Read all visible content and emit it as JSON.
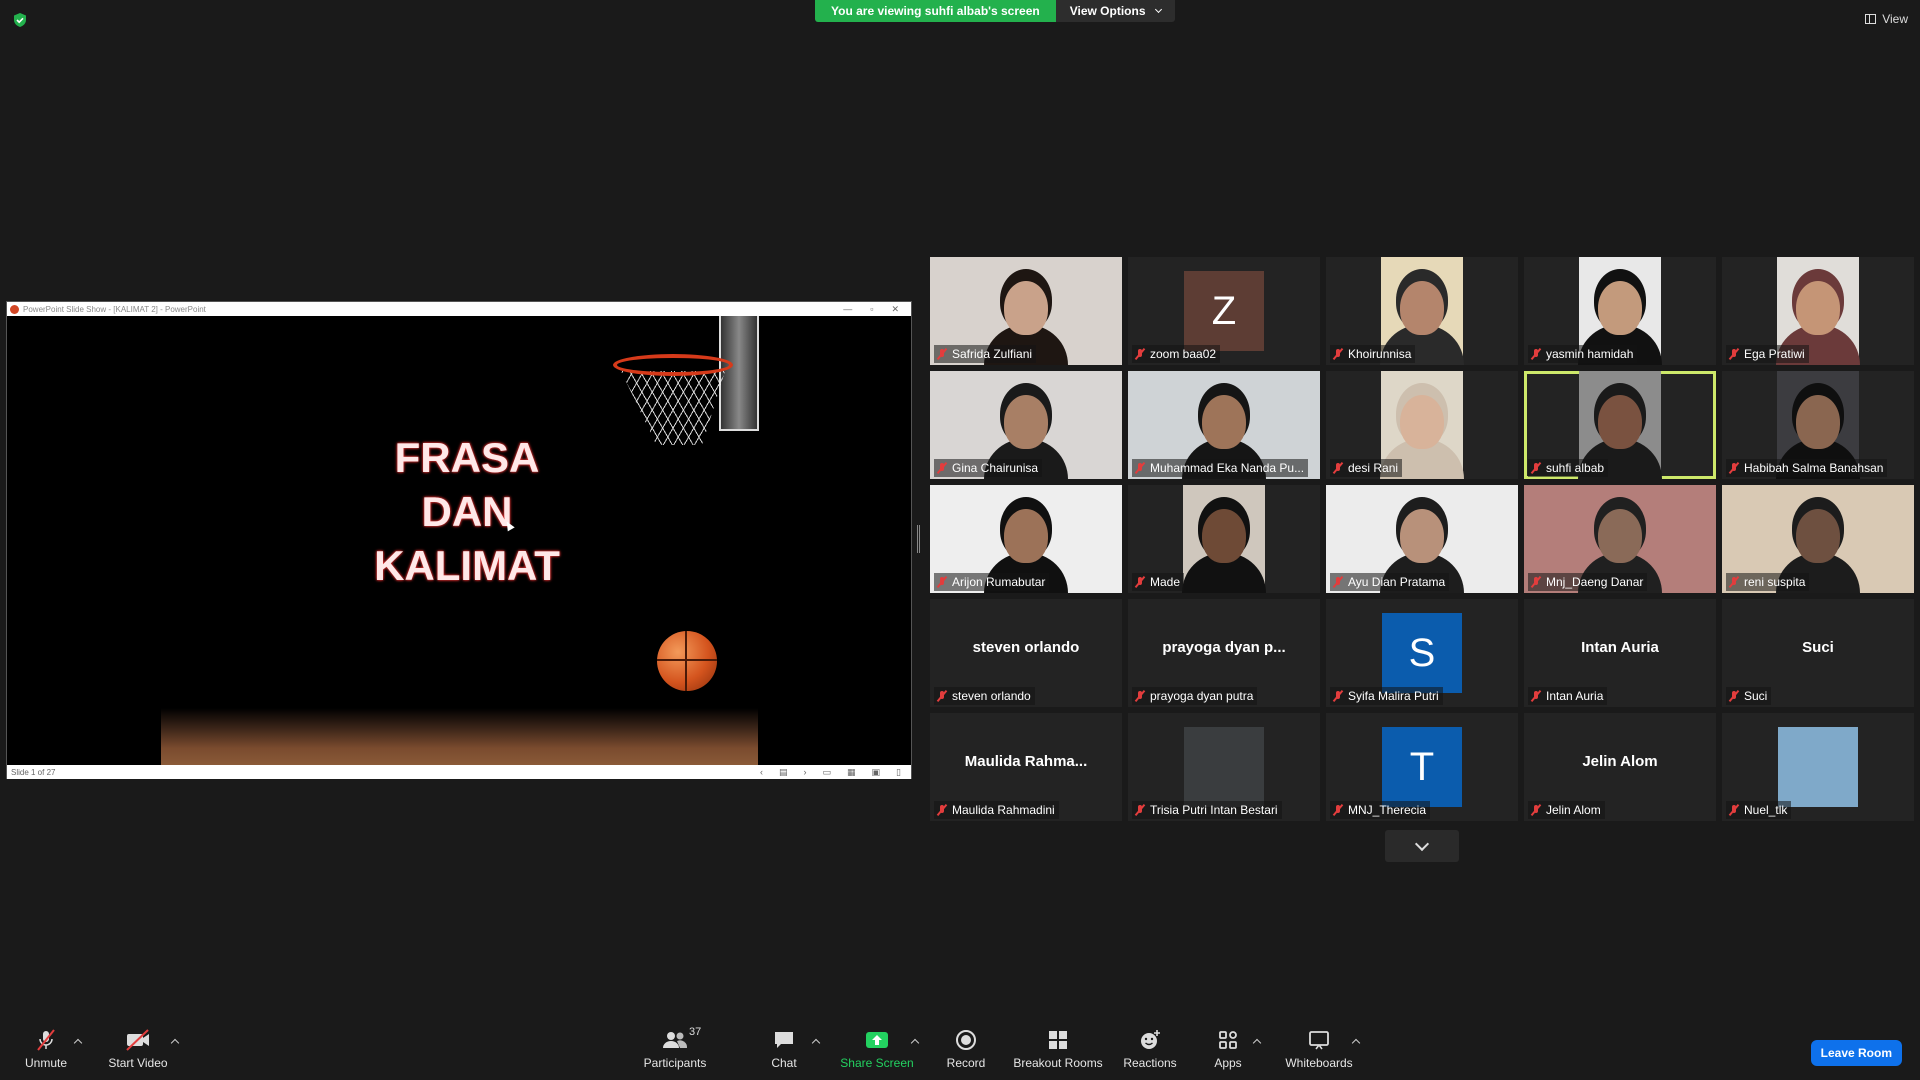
{
  "top": {
    "viewing_text": "You are viewing suhfi albab's screen",
    "view_options_label": "View Options",
    "view_label": "View"
  },
  "shared_window": {
    "title": "PowerPoint Slide Show - [KALIMAT 2] - PowerPoint",
    "slide_title_lines": [
      "FRASA",
      "DAN",
      "KALIMAT"
    ],
    "slide_counter": "Slide 1 of 27"
  },
  "participants": [
    {
      "label": "Safrida Zulfiani",
      "kind": "video",
      "skin": "#c9a28a",
      "bg": "#d8d2cd",
      "hair": "#1e1612"
    },
    {
      "label": "zoom baa02",
      "kind": "avatar",
      "initial": "Z",
      "avatar_color": "#5d3d34"
    },
    {
      "label": "Khoirunnisa",
      "kind": "video",
      "skin": "#b4856c",
      "bg": "#e6d9b8",
      "hair": "#2a2a2a"
    },
    {
      "label": "yasmin hamidah",
      "kind": "video",
      "skin": "#c39a7c",
      "bg": "#e8e8e8",
      "hair": "#111111"
    },
    {
      "label": "Ega Pratiwi",
      "kind": "video",
      "skin": "#c59576",
      "bg": "#e0ddd9",
      "hair": "#6b3a3a"
    },
    {
      "label": "Gina Chairunisa",
      "kind": "video",
      "skin": "#a87f65",
      "bg": "#d9d6d4",
      "hair": "#1a1a1a"
    },
    {
      "label": "Muhammad Eka Nanda Pu...",
      "kind": "video",
      "skin": "#9e7459",
      "bg": "#cfd3d6",
      "hair": "#151515"
    },
    {
      "label": "desi Rani",
      "kind": "video",
      "skin": "#d8b39a",
      "bg": "#ded7c8",
      "hair": "#cdbfae"
    },
    {
      "label": "suhfi albab",
      "kind": "video",
      "skin": "#7a5240",
      "bg": "#8c8c8c",
      "hair": "#1a1a1a",
      "active": true
    },
    {
      "label": "Habibah Salma Banahsan",
      "kind": "video",
      "skin": "#8a6650",
      "bg": "#3c3c40",
      "hair": "#0f0f0f"
    },
    {
      "label": "Arijon Rumabutar",
      "kind": "video",
      "skin": "#9c7258",
      "bg": "#eeeeee",
      "hair": "#101010"
    },
    {
      "label": "Made",
      "kind": "video",
      "skin": "#6e4a36",
      "bg": "#cfc7bd",
      "hair": "#111111"
    },
    {
      "label": "Ayu Dian Pratama",
      "kind": "video",
      "skin": "#b8917a",
      "bg": "#ececec",
      "hair": "#1d1d1d"
    },
    {
      "label": "Mnj_Daeng Danar",
      "kind": "video",
      "skin": "#8a6a58",
      "bg": "#b47e7a",
      "hair": "#202020"
    },
    {
      "label": "reni suspita",
      "kind": "video",
      "skin": "#6e5040",
      "bg": "#d9c9b4",
      "hair": "#1c1c1c"
    },
    {
      "label": "steven orlando",
      "kind": "name",
      "display_name": "steven orlando"
    },
    {
      "label": "prayoga dyan putra",
      "kind": "name",
      "display_name": "prayoga  dyan  p..."
    },
    {
      "label": "Syifa Malira Putri",
      "kind": "avatar",
      "initial": "S",
      "avatar_color": "#0b5cad"
    },
    {
      "label": "Intan Auria",
      "kind": "name",
      "display_name": "Intan Auria"
    },
    {
      "label": "Suci",
      "kind": "name",
      "display_name": "Suci"
    },
    {
      "label": "Maulida Rahmadini",
      "kind": "name",
      "display_name": "Maulida  Rahma..."
    },
    {
      "label": "Trisia Putri Intan Bestari",
      "kind": "photo",
      "bg": "#3a3d3f"
    },
    {
      "label": "MNJ_Therecia",
      "kind": "avatar",
      "initial": "T",
      "avatar_color": "#0b5cad"
    },
    {
      "label": "Jelin Alom",
      "kind": "name",
      "display_name": "Jelin Alom"
    },
    {
      "label": "Nuel_tlk",
      "kind": "photo",
      "bg": "#7fa9c9"
    }
  ],
  "toolbar": {
    "unmute": "Unmute",
    "start_video": "Start Video",
    "participants": "Participants",
    "participants_count": "37",
    "chat": "Chat",
    "share_screen": "Share Screen",
    "record": "Record",
    "breakout_rooms": "Breakout Rooms",
    "reactions": "Reactions",
    "apps": "Apps",
    "whiteboards": "Whiteboards",
    "leave": "Leave Room"
  },
  "colors": {
    "accent_green": "#23b14d",
    "active_speaker": "#cde86a",
    "leave_blue": "#0e71eb",
    "muted_red": "#e23d3d"
  }
}
